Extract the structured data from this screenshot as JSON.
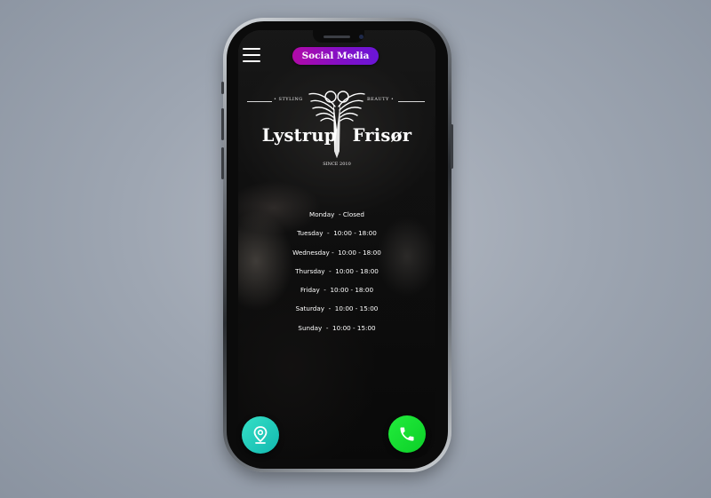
{
  "header": {
    "menu_icon": "hamburger-menu-icon",
    "social_button_label": "Social Media"
  },
  "logo": {
    "tag_left": "• STYLING",
    "tag_right": "BEAUTY •",
    "name_left": "Lystrup",
    "name_right": "Frisør",
    "since": "SINCE 2010",
    "emblem_icon": "scissors-wings-icon"
  },
  "hours": [
    {
      "label": "Monday  - Closed"
    },
    {
      "label": "Tuesday  -  10:00 - 18:00"
    },
    {
      "label": "Wednesday -  10:00 - 18:00"
    },
    {
      "label": "Thursday  -  10:00 - 18:00"
    },
    {
      "label": "Friday  -  10:00 - 18:00"
    },
    {
      "label": "Saturday  -  10:00 - 15:00"
    },
    {
      "label": "Sunday  -  10:00 - 15:00"
    }
  ],
  "actions": {
    "map_icon": "location-pin-icon",
    "call_icon": "phone-icon"
  },
  "colors": {
    "social_gradient_start": "#b10aa8",
    "social_gradient_end": "#6a16d8",
    "map_button": "#1cc9b8",
    "call_button": "#16dc30",
    "page_background": "#9ea6b2"
  }
}
